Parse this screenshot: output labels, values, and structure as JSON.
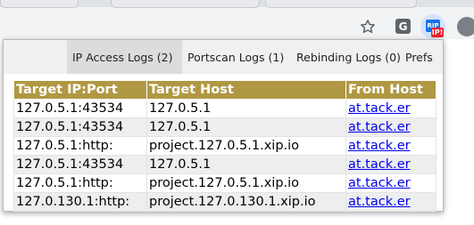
{
  "toolbar": {
    "bookmark_icon": "star-outline-icon",
    "extensions": [
      {
        "icon": "grammarly-icon",
        "label": "G"
      },
      {
        "icon": "ripe-ip-extension-icon",
        "label": "RIP",
        "badge": "IP!"
      }
    ],
    "profile_icon": "profile-avatar-icon"
  },
  "tabs": [
    {
      "label": "IP Access Logs (2)",
      "active": true
    },
    {
      "label": "Portscan Logs (1)",
      "active": false
    },
    {
      "label": "Rebinding Logs (0)",
      "active": false
    },
    {
      "label": "Prefs",
      "active": false
    }
  ],
  "table": {
    "headers": [
      "Target IP:Port",
      "Target Host",
      "From Host"
    ],
    "rows": [
      [
        "127.0.5.1:43534",
        "127.0.5.1",
        "at.tack.er"
      ],
      [
        "127.0.5.1:43534",
        "127.0.5.1",
        "at.tack.er"
      ],
      [
        "127.0.5.1:http:",
        "project.127.0.5.1.xip.io",
        "at.tack.er"
      ],
      [
        "127.0.5.1:43534",
        "127.0.5.1",
        "at.tack.er"
      ],
      [
        "127.0.5.1:http:",
        "project.127.0.5.1.xip.io",
        "at.tack.er"
      ],
      [
        "127.0.130.1:http:",
        "project.127.0.130.1.xip.io",
        "at.tack.er"
      ]
    ]
  },
  "colors": {
    "header_bg": "#b09843",
    "header_text": "#ffffff",
    "link": "#0000ee",
    "active_tab_bg": "#dcdcdc",
    "tabs_bg": "#f0f0f0"
  }
}
